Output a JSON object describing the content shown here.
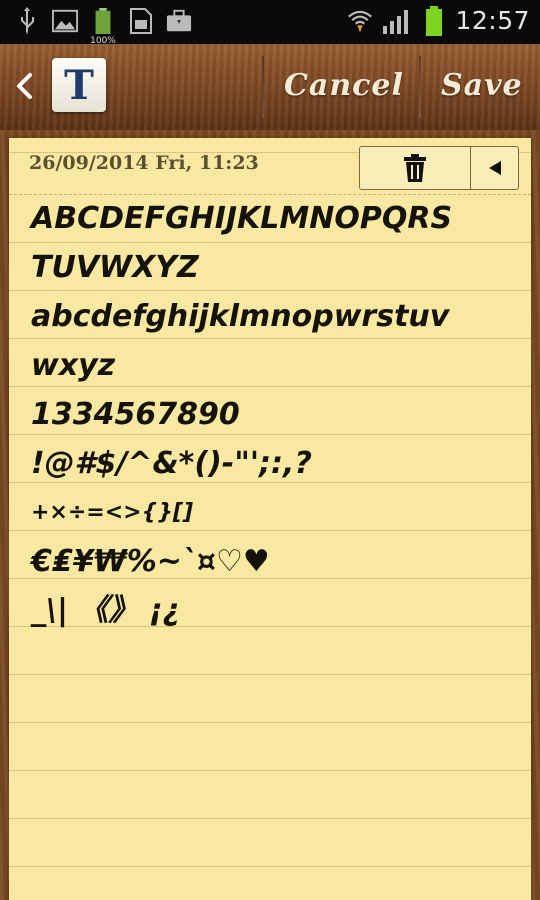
{
  "status_bar": {
    "time": "12:57",
    "battery_label": "100%",
    "icons": [
      "usb-icon",
      "image-icon",
      "battery-full-icon",
      "sd-card-icon",
      "briefcase-icon",
      "wifi-icon",
      "signal-icon",
      "battery-icon"
    ]
  },
  "action_bar": {
    "font_button_label": "T",
    "cancel_label": "Cancel",
    "save_label": "Save"
  },
  "note": {
    "date": "26/09/2014 Fri, 11:23",
    "lines": [
      "ABCDEFGHIJKLMNOPQRS",
      "TUVWXYZ",
      "abcdefghijklmnopwrstuv",
      "wxyz",
      "1334567890",
      "!@#$/^&*()-\"';:,?",
      "+×÷=<>{}[]",
      "€₤¥₩%~`¤♡♥",
      "_\\| 《》 ¡¿"
    ]
  },
  "colors": {
    "paper": "#f8e8a2",
    "wood": "#7d4a25",
    "status_bar": "#0a0a0a",
    "battery_green": "#7ed321"
  }
}
